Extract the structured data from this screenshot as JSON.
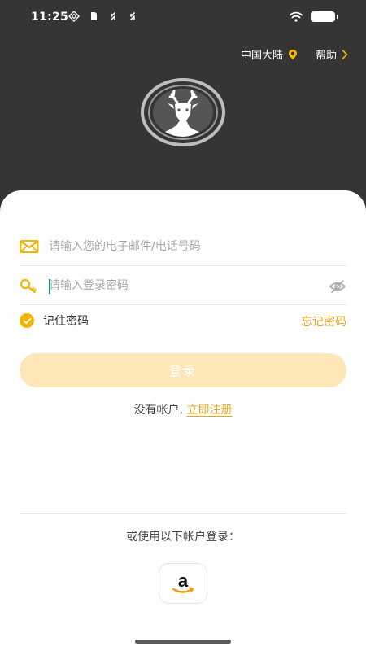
{
  "status_bar": {
    "time": "11:25",
    "left_icons": [
      "nfc-icon",
      "sim-icon",
      "sync-icon",
      "sync-icon"
    ],
    "right_icons": [
      "wifi-icon",
      "battery-icon"
    ]
  },
  "header": {
    "region_label": "中国大陆",
    "region_icon": "location-pin-icon",
    "help_label": "帮助",
    "help_icon": "chevron-right-icon",
    "logo_icon": "deer-logo-icon"
  },
  "login_form": {
    "email_placeholder": "请输入您的电子邮件/电话号码",
    "email_value": "",
    "email_icon": "envelope-icon",
    "password_placeholder": "请输入登录密码",
    "password_value": "",
    "password_icon": "key-icon",
    "visibility_icon": "eye-slash-icon",
    "remember_label": "记住密码",
    "remember_checked": true,
    "forgot_label": "忘记密码",
    "login_label": "登录"
  },
  "register": {
    "prompt": "没有帐户, ",
    "link_label": "立即注册"
  },
  "alternative": {
    "label": "或使用以下帐户登录：",
    "providers": [
      {
        "name": "amazon",
        "icon": "amazon-icon"
      }
    ]
  },
  "colors": {
    "header_bg": "#353535",
    "accent": "#f4b400",
    "accent_text": "#e9a41a",
    "button_disabled": "#fde6b8",
    "card_bg": "#ffffff"
  }
}
